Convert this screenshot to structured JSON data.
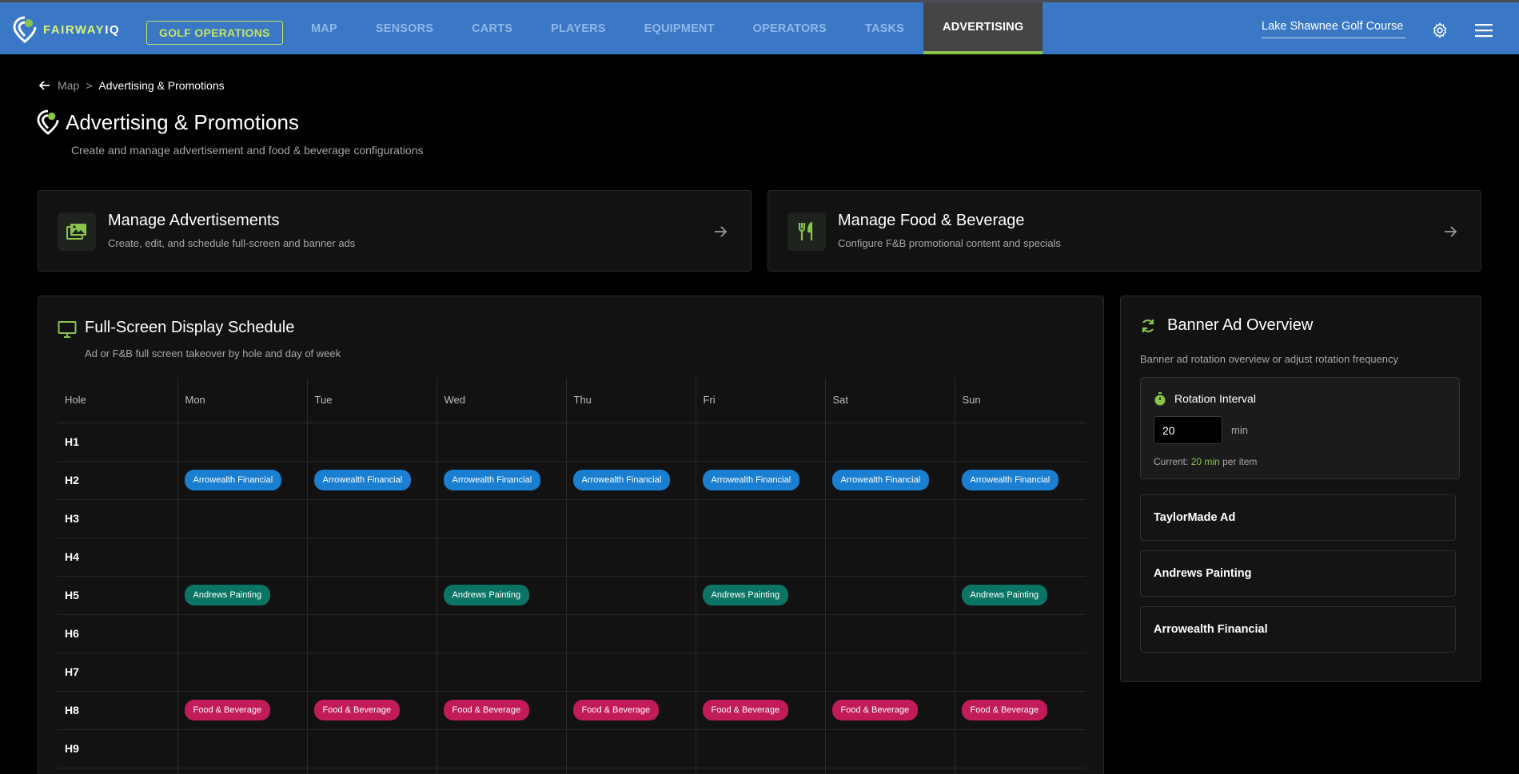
{
  "brand": {
    "name_a": "FAIRWAY",
    "name_b": "IQ",
    "accent": "#8bc34a"
  },
  "topbar": {
    "golf_ops": "GOLF OPERATIONS",
    "nav": [
      "MAP",
      "SENSORS",
      "CARTS",
      "PLAYERS",
      "EQUIPMENT",
      "OPERATORS",
      "TASKS",
      "ADVERTISING"
    ],
    "active": "ADVERTISING",
    "course": "Lake Shawnee Golf Course"
  },
  "breadcrumb": {
    "parent": "Map",
    "separator": ">",
    "current": "Advertising & Promotions"
  },
  "page": {
    "title": "Advertising & Promotions",
    "subtitle": "Create and manage advertisement and food & beverage configurations"
  },
  "cards": {
    "ads": {
      "title": "Manage Advertisements",
      "desc": "Create, edit, and schedule full-screen and banner ads",
      "icon": "image-gallery-icon"
    },
    "fb": {
      "title": "Manage Food & Beverage",
      "desc": "Configure F&B promotional content and specials",
      "icon": "fork-knife-icon"
    }
  },
  "schedule": {
    "title": "Full-Screen Display Schedule",
    "desc": "Ad or F&B full screen takeover by hole and day of week",
    "columns": [
      "Hole",
      "Mon",
      "Tue",
      "Wed",
      "Thu",
      "Fri",
      "Sat",
      "Sun"
    ],
    "rows": [
      {
        "hole": "H1",
        "cells": [
          "",
          "",
          "",
          "",
          "",
          "",
          ""
        ]
      },
      {
        "hole": "H2",
        "cells": [
          "Arrowealth Financial",
          "Arrowealth Financial",
          "Arrowealth Financial",
          "Arrowealth Financial",
          "Arrowealth Financial",
          "Arrowealth Financial",
          "Arrowealth Financial"
        ]
      },
      {
        "hole": "H3",
        "cells": [
          "",
          "",
          "",
          "",
          "",
          "",
          ""
        ]
      },
      {
        "hole": "H4",
        "cells": [
          "",
          "",
          "",
          "",
          "",
          "",
          ""
        ]
      },
      {
        "hole": "H5",
        "cells": [
          "Andrews Painting",
          "",
          "Andrews Painting",
          "",
          "Andrews Painting",
          "",
          "Andrews Painting"
        ]
      },
      {
        "hole": "H6",
        "cells": [
          "",
          "",
          "",
          "",
          "",
          "",
          ""
        ]
      },
      {
        "hole": "H7",
        "cells": [
          "",
          "",
          "",
          "",
          "",
          "",
          ""
        ]
      },
      {
        "hole": "H8",
        "cells": [
          "Food & Beverage",
          "Food & Beverage",
          "Food & Beverage",
          "Food & Beverage",
          "Food & Beverage",
          "Food & Beverage",
          "Food & Beverage"
        ]
      },
      {
        "hole": "H9",
        "cells": [
          "",
          "",
          "",
          "",
          "",
          "",
          ""
        ]
      },
      {
        "hole": "",
        "cells": [
          "",
          "",
          "",
          "",
          "",
          "",
          ""
        ]
      }
    ],
    "chip_colors": {
      "Arrowealth Financial": "#1b7fd1",
      "Andrews Painting": "#0b7565",
      "Food & Beverage": "#c21b5a"
    }
  },
  "banner": {
    "title": "Banner Ad Overview",
    "desc": "Banner ad rotation overview or adjust rotation frequency",
    "rotation_label": "Rotation Interval",
    "rotation_value": "20",
    "unit": "min",
    "current_prefix": "Current:",
    "current_value": "20 min",
    "current_suffix": "per item",
    "ads": [
      "TaylorMade Ad",
      "Andrews Painting",
      "Arrowealth Financial"
    ]
  }
}
